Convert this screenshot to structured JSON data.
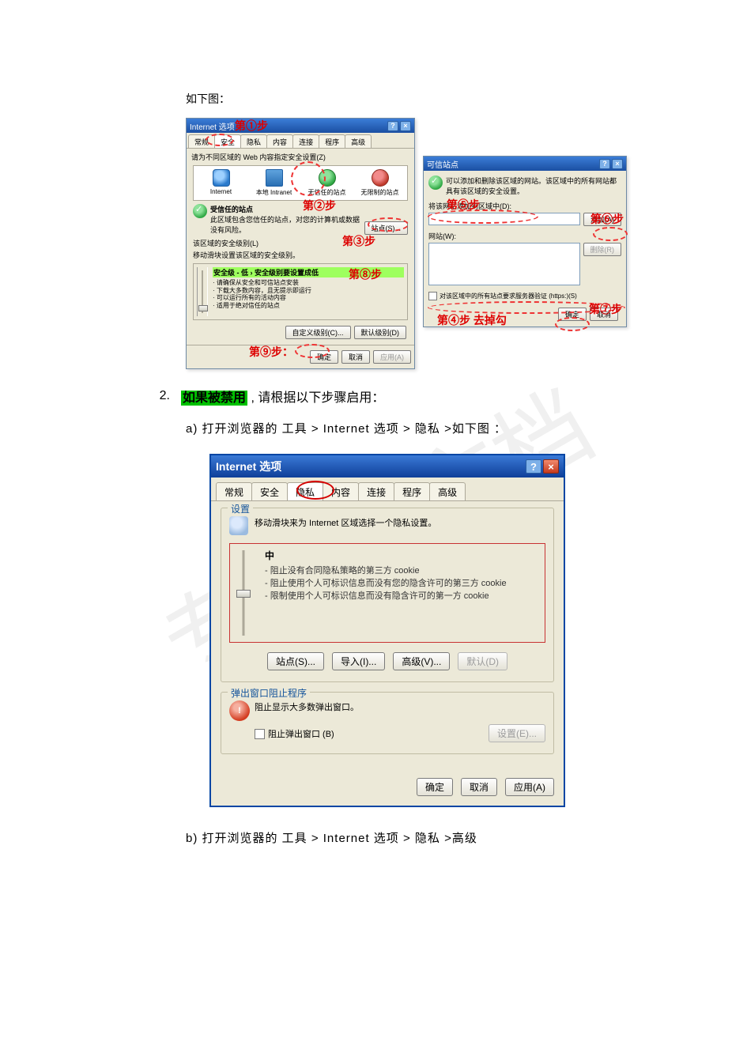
{
  "intro": "如下图：",
  "screenshot1": {
    "leftWin": {
      "title": "Internet 选项",
      "tabs": [
        "常规",
        "安全",
        "隐私",
        "内容",
        "连接",
        "程序",
        "高级"
      ],
      "activeTabIndex": 1,
      "zoneHint": "请为不同区域的 Web 内容指定安全设置(Z)",
      "zones": [
        {
          "name": "Internet",
          "icon": "globe"
        },
        {
          "name": "本地 Intranet",
          "icon": "intra"
        },
        {
          "name": "无信任的站点",
          "icon": "trust"
        },
        {
          "name": "无限制的站点",
          "icon": "restr"
        }
      ],
      "trustedTitle": "受信任的站点",
      "trustedDesc": "此区域包含您信任的站点，对您的计算机或数据没有风险。",
      "sitesBtn": "站点(S)...",
      "secLevelTitle": "该区域的安全级别(L)",
      "secLevelHint": "移动滑块设置该区域的安全级别。",
      "secLevelHL": "安全级 - 低 › 安全级别要设置成低",
      "secLevelBul": [
        "请确保从安全和可信站点安装",
        "下载大多数内容，且无提示即运行",
        "可以运行所有的活动内容",
        "适用于绝对信任的站点"
      ],
      "customBtn": "自定义级别(C)...",
      "defaultBtn": "默认级别(D)",
      "ok": "确定",
      "cancel": "取消",
      "apply": "应用(A)"
    },
    "rightWin": {
      "title": "可信站点",
      "desc": "可以添加和删除该区域的网站。该区域中的所有网站都具有该区域的安全设置。",
      "addLabel": "将该网站添加到区域中(D):",
      "addBtn": "添加(A)",
      "sitesLabel": "网站(W):",
      "removeBtn": "删除(R)",
      "chkLabel": "对该区域中的所有站点要求服务器验证 (https:)(S)",
      "ok": "确定",
      "cancel": "取消"
    },
    "steps": {
      "s1": "第①步",
      "s2": "第②步",
      "s3": "第③步",
      "s4": "第④步 去掉勾",
      "s5": "第⑤步",
      "s6": "第⑥步",
      "s7": "第⑦步",
      "s8": "第⑧步",
      "s9": "第⑨步："
    }
  },
  "para2": {
    "num": "2.",
    "hl": "如果被禁用",
    "rest": " , 请根据以下步骤启用：",
    "a": "a)  打开浏览器的 工具 > Internet 选项 > 隐私 >如下图 ：",
    "b": "b)  打开浏览器的 工具 > Internet 选项 > 隐私 >高级"
  },
  "screenshot2": {
    "title": "Internet 选项",
    "tabs": [
      "常规",
      "安全",
      "隐私",
      "内容",
      "连接",
      "程序",
      "高级"
    ],
    "activeTabIndex": 2,
    "grp1Title": "设置",
    "hint": "移动滑块来为 Internet 区域选择一个隐私设置。",
    "level": "中",
    "bullets": [
      "阻止没有合同隐私策略的第三方 cookie",
      "阻止使用个人可标识信息而没有您的隐含许可的第三方 cookie",
      "限制使用个人可标识信息而没有隐含许可的第一方 cookie"
    ],
    "btnSites": "站点(S)...",
    "btnImport": "导入(I)...",
    "btnAdv": "高级(V)...",
    "btnDefault": "默认(D)",
    "grp2Title": "弹出窗口阻止程序",
    "blockHint": "阻止显示大多数弹出窗口。",
    "blockChk": "阻止弹出窗口 (B)",
    "btnSettings": "设置(E)...",
    "ok": "确定",
    "cancel": "取消",
    "apply": "应用(A)"
  },
  "watermark": "专业好文档"
}
